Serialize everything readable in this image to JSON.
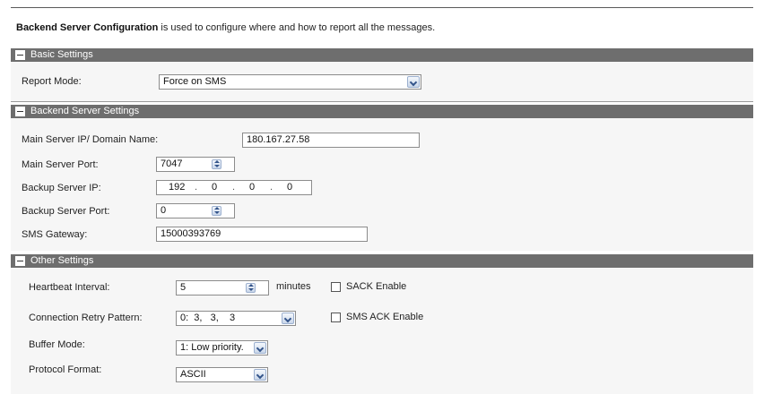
{
  "intro": {
    "title": "Backend Server Configuration",
    "description": "is used to configure where and how to report all the messages."
  },
  "basic": {
    "header": "Basic Settings",
    "report_mode_label": "Report Mode:",
    "report_mode_value": "Force on SMS"
  },
  "backend": {
    "header": "Backend Server Settings",
    "main_ip_label": "Main Server IP/ Domain Name:",
    "main_ip_value": "180.167.27.58",
    "main_port_label": "Main Server Port:",
    "main_port_value": "7047",
    "backup_ip_label": "Backup Server IP:",
    "backup_ip_octets": [
      "192",
      "0",
      "0",
      "0"
    ],
    "backup_port_label": "Backup Server Port:",
    "backup_port_value": "0",
    "sms_gateway_label": "SMS Gateway:",
    "sms_gateway_value": "15000393769"
  },
  "other": {
    "header": "Other Settings",
    "heartbeat_label": "Heartbeat Interval:",
    "heartbeat_value": "5",
    "heartbeat_unit": "minutes",
    "sack_label": "SACK Enable",
    "sack_checked": false,
    "retry_label": "Connection Retry Pattern:",
    "retry_value": "0:  3,   3,    3",
    "sms_ack_label": "SMS ACK Enable",
    "sms_ack_checked": false,
    "buffer_label": "Buffer Mode:",
    "buffer_value": "1: Low priority.",
    "protocol_label": "Protocol Format:",
    "protocol_value": "ASCII"
  },
  "icons": {
    "collapse": "minus-square-icon",
    "dropdown": "chevron-down-icon",
    "spinner": "up-down-arrows-icon"
  },
  "colors": {
    "section_header_bg": "#6e6e6e",
    "section_body_bg": "#f6f6f6",
    "control_accent": "#33548a"
  }
}
